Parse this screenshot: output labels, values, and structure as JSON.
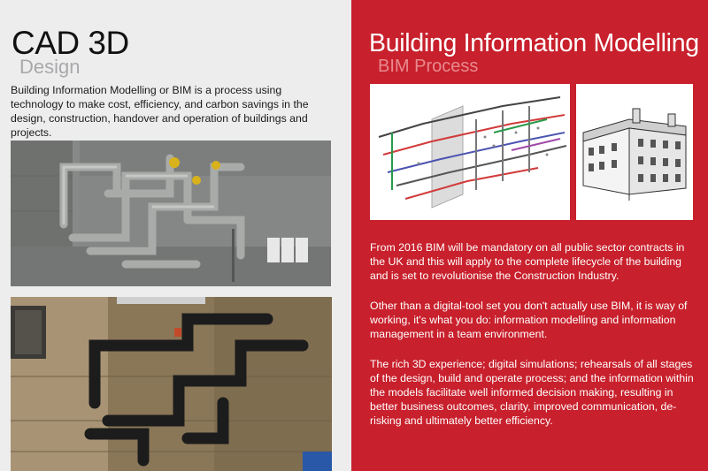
{
  "left": {
    "title": "CAD 3D",
    "subtitle": "Design",
    "intro": "Building Information Modelling or BIM is a process using technology to make cost, efficiency, and carbon savings in the design, construction, handover and operation of buildings and projects."
  },
  "right": {
    "title": "Building Information Modelling",
    "subtitle": "BIM Process",
    "paragraphs": [
      "From 2016 BIM will be mandatory on all public sector contracts in the UK and this will apply to the complete lifecycle of the building and is set to revolutionise the Construction Industry.",
      "Other than a digital-tool set you don't actually use BIM, it is way of working, it's what you do: information modelling and information management in a team environment.",
      "The rich 3D experience; digital simulations; rehearsals of all stages of the design, build and operate process; and the information within the models facilitate well informed decision making, resulting in better business outcomes, clarity, improved communication, de-risking and ultimately better efficiency."
    ]
  },
  "colors": {
    "left_background": "#ededee",
    "right_background": "#c8202c",
    "heading_text": "#111111",
    "subtitle_grey": "#a9a9ab",
    "subtitle_pink": "#e88a8f"
  }
}
